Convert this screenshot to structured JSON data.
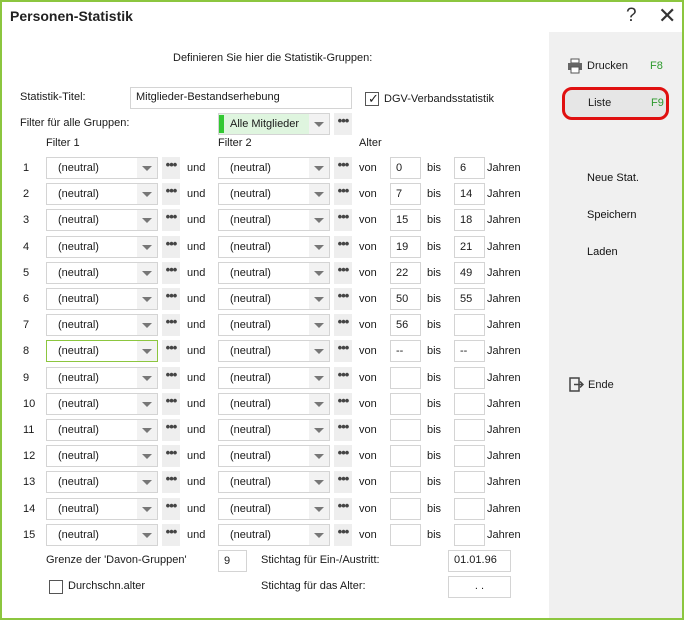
{
  "window": {
    "title": "Personen-Statistik",
    "help_glyph": "?",
    "close_glyph": "✕"
  },
  "heading": "Definieren Sie hier die Statistik-Gruppen:",
  "stat_title_label": "Statistik-Titel:",
  "stat_title_value": "Mitglieder-Bestandserhebung",
  "dgv_checkbox": {
    "label": "DGV-Verbandsstatistik",
    "checked": true
  },
  "filter_all_label": "Filter für alle Gruppen:",
  "filter_all_value": "Alle Mitglieder",
  "col_headers": {
    "filter1": "Filter 1",
    "filter2": "Filter 2",
    "alter": "Alter"
  },
  "words": {
    "und": "und",
    "von": "von",
    "bis": "bis",
    "jahren": "Jahren"
  },
  "rows": [
    {
      "n": "1",
      "f1": "(neutral)",
      "f2": "(neutral)",
      "von": "0",
      "bis": "6"
    },
    {
      "n": "2",
      "f1": "(neutral)",
      "f2": "(neutral)",
      "von": "7",
      "bis": "14"
    },
    {
      "n": "3",
      "f1": "(neutral)",
      "f2": "(neutral)",
      "von": "15",
      "bis": "18"
    },
    {
      "n": "4",
      "f1": "(neutral)",
      "f2": "(neutral)",
      "von": "19",
      "bis": "21"
    },
    {
      "n": "5",
      "f1": "(neutral)",
      "f2": "(neutral)",
      "von": "22",
      "bis": "49"
    },
    {
      "n": "6",
      "f1": "(neutral)",
      "f2": "(neutral)",
      "von": "50",
      "bis": "55"
    },
    {
      "n": "7",
      "f1": "(neutral)",
      "f2": "(neutral)",
      "von": "56",
      "bis": ""
    },
    {
      "n": "8",
      "f1": "(neutral)",
      "f2": "(neutral)",
      "von": "--",
      "bis": "--"
    },
    {
      "n": "9",
      "f1": "(neutral)",
      "f2": "(neutral)",
      "von": "",
      "bis": ""
    },
    {
      "n": "10",
      "f1": "(neutral)",
      "f2": "(neutral)",
      "von": "",
      "bis": ""
    },
    {
      "n": "11",
      "f1": "(neutral)",
      "f2": "(neutral)",
      "von": "",
      "bis": ""
    },
    {
      "n": "12",
      "f1": "(neutral)",
      "f2": "(neutral)",
      "von": "",
      "bis": ""
    },
    {
      "n": "13",
      "f1": "(neutral)",
      "f2": "(neutral)",
      "von": "",
      "bis": ""
    },
    {
      "n": "14",
      "f1": "(neutral)",
      "f2": "(neutral)",
      "von": "",
      "bis": ""
    },
    {
      "n": "15",
      "f1": "(neutral)",
      "f2": "(neutral)",
      "von": "",
      "bis": ""
    }
  ],
  "davon_label": "Grenze der 'Davon-Gruppen'",
  "davon_value": "9",
  "stichtag_eintritt_label": "Stichtag für Ein-/Austritt:",
  "stichtag_eintritt_value": "01.01.96",
  "stichtag_alter_label": "Stichtag für das Alter:",
  "stichtag_alter_value": ". .",
  "durchschn": {
    "label": "Durchschn.alter",
    "checked": false
  },
  "right_panel": {
    "drucken": {
      "label": "Drucken",
      "key": "F8",
      "icon": "printer-icon"
    },
    "liste": {
      "label": "Liste",
      "key": "F9"
    },
    "neue_stat": "Neue Stat.",
    "speichern": "Speichern",
    "laden": "Laden",
    "ende": {
      "label": "Ende",
      "icon": "exit-icon"
    }
  },
  "colors": {
    "border_accent": "#8cc63f",
    "highlight_ring": "#e01010",
    "key_hint": "#2e9a2e",
    "filter_indicator": "#32c832"
  }
}
